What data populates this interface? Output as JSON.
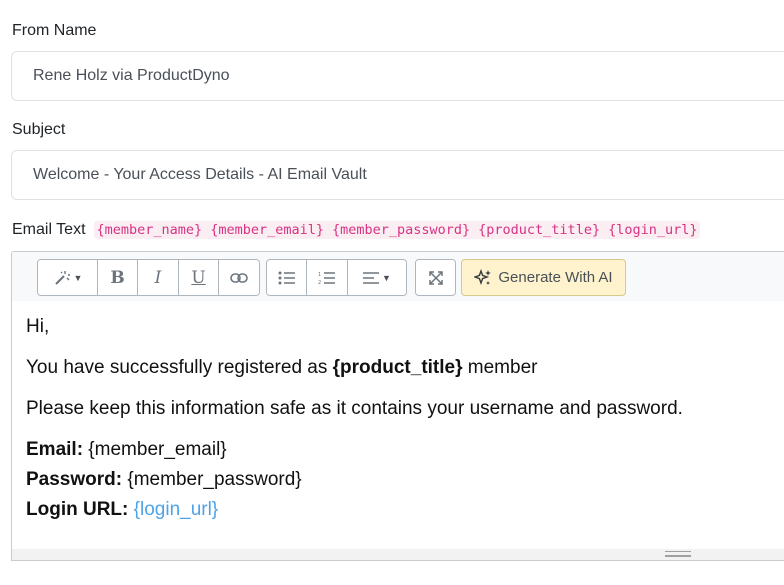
{
  "from_name": {
    "label": "From Name",
    "value": "Rene Holz via ProductDyno"
  },
  "subject": {
    "label": "Subject",
    "value": "Welcome - Your Access Details - AI Email Vault"
  },
  "email_text": {
    "label": "Email Text",
    "placeholders": [
      "{member_name}",
      "{member_email}",
      "{member_password}",
      "{product_title}",
      "{login_url}"
    ]
  },
  "toolbar": {
    "groups": [
      [
        "magic-icon"
      ],
      [
        "bold-icon",
        "italic-icon",
        "underline-icon",
        "link-icon"
      ],
      [
        "unordered-list-icon",
        "ordered-list-icon",
        "align-icon"
      ],
      [
        "fullscreen-icon"
      ]
    ],
    "generate_ai_label": "Generate With AI",
    "accent_color": "#fff3cd"
  },
  "body": {
    "greeting": "Hi,",
    "registered_prefix": "You have successfully registered as ",
    "registered_tag": "{product_title}",
    "registered_suffix": " member",
    "keep_safe": "Please keep this information safe as it contains your username and password.",
    "email_label": "Email:",
    "email_value": " {member_email}",
    "password_label": "Password:",
    "password_value": " {member_password}",
    "login_label": "Login URL:",
    "login_value": "{login_url}",
    "link_color": "#4ea3e6"
  }
}
